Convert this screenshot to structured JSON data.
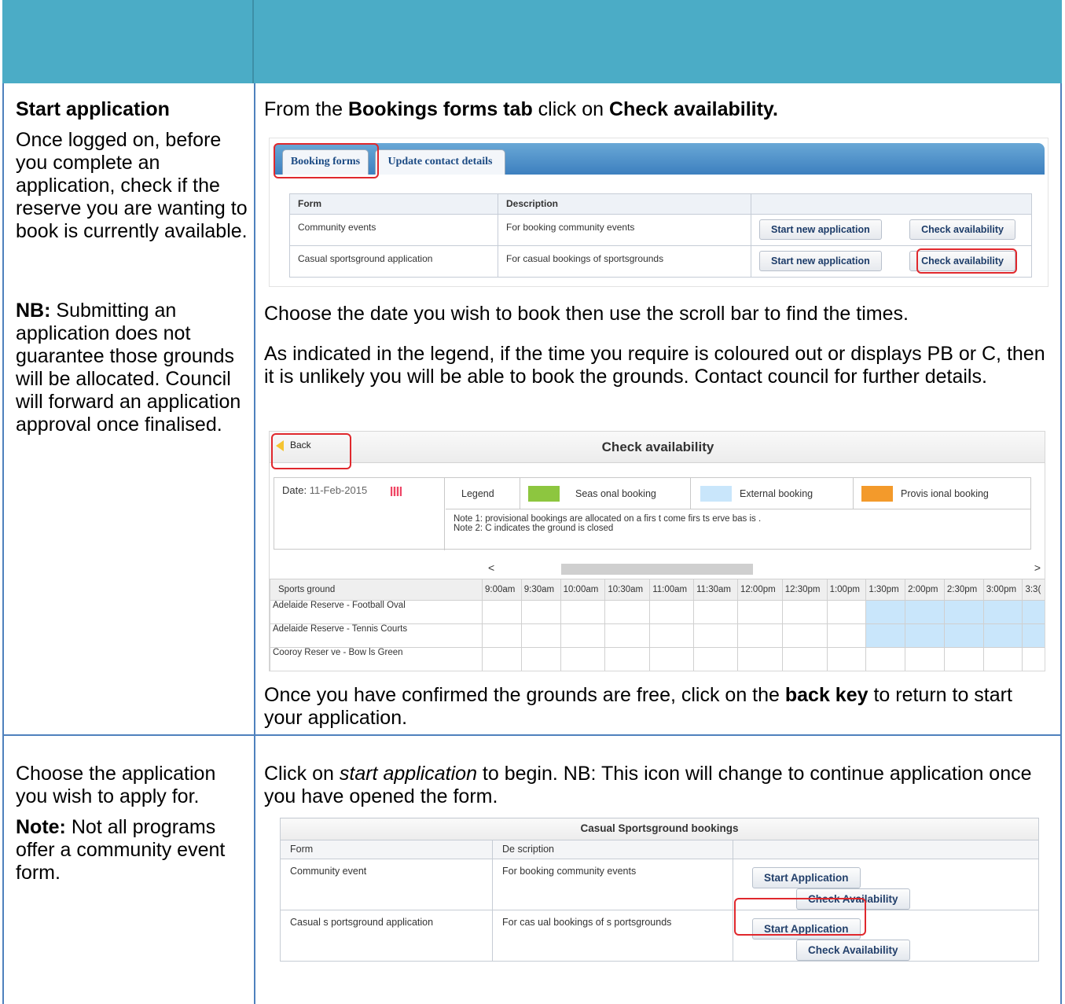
{
  "row1": {
    "left": {
      "heading": "Start application",
      "para1": "Once logged on, before you complete an application, check if the reserve you are wanting to book is currently available.",
      "nb_label": "NB:",
      "nb_text": "Submitting an application does not guarantee those grounds will be allocated. Council will forward an application approval once finalised."
    },
    "right": {
      "intro_prefix": "From the ",
      "intro_bold1": "Bookings forms tab",
      "intro_mid": " click on ",
      "intro_bold2": "Check availability.",
      "para_date": "Choose the date you wish to book then use the scroll bar to find the times.",
      "para_legend": "As indicated in the legend, if the time you require is coloured out or displays PB or C, then it is unlikely you will be able to book the grounds. Contact council for further details.",
      "outro_prefix": "Once you have confirmed the grounds are free, click on the ",
      "outro_bold": "back key",
      "outro_suffix": " to return to start your application."
    }
  },
  "row2": {
    "left": {
      "para1": "Choose the application you wish to apply for.",
      "note_label": "Note:",
      "note_text": "Not all programs offer a community event form."
    },
    "right": {
      "intro_prefix": "Click on ",
      "intro_italic": "start application",
      "intro_suffix": " to begin. NB: This icon will change to continue application once you have opened the form."
    }
  },
  "shot_forms": {
    "tabs": [
      "Booking forms",
      "Update contact details"
    ],
    "headers": [
      "Form",
      "Description",
      ""
    ],
    "rows": [
      {
        "form": "Community events",
        "desc": "For booking community events",
        "start": "Start new application",
        "check": "Check availability"
      },
      {
        "form": "Casual sportsground application",
        "desc": "For casual bookings of sportsgrounds",
        "start": "Start new application",
        "check": "Check availability"
      }
    ]
  },
  "shot_availability": {
    "title": "Check availability",
    "back": "Back",
    "date_label": "Date:",
    "date_value": "11-Feb-2015",
    "legend_label": "Legend",
    "legend": [
      {
        "label": "Seas onal booking",
        "color": "#8dc63f"
      },
      {
        "label": "External booking",
        "color": "#c9e6fb"
      },
      {
        "label": "Provis ional booking",
        "color": "#f39a2b"
      }
    ],
    "note1": "Note 1: provisional bookings are allocated on a firs t come firs ts erve bas is .",
    "note2": "Note 2: C indicates the ground is closed",
    "scroll_left": "<",
    "scroll_right": ">",
    "col_header": "Sports ground",
    "times": [
      "9:00am",
      "9:30am",
      "10:00am",
      "10:30am",
      "11:00am",
      "11:30am",
      "12:00pm",
      "12:30pm",
      "1:00pm",
      "1:30pm",
      "2:00pm",
      "2:30pm",
      "3:00pm",
      "3:3("
    ],
    "grounds": [
      "Adelaide Reserve - Football Oval",
      "Adelaide Reserve - Tennis Courts",
      "Cooroy Reser ve - Bow ls Green"
    ]
  },
  "shot_casual": {
    "caption": "Casual Sportsground bookings",
    "headers": [
      "Form",
      "De scription",
      ""
    ],
    "rows": [
      {
        "form": "Community event",
        "desc": "For booking community events",
        "start": "Start Application",
        "check": "Check Availability"
      },
      {
        "form": "Casual s portsground application",
        "desc": "For cas ual bookings of s portsgrounds",
        "start": "Start Application",
        "check": "Check Availability"
      }
    ]
  }
}
